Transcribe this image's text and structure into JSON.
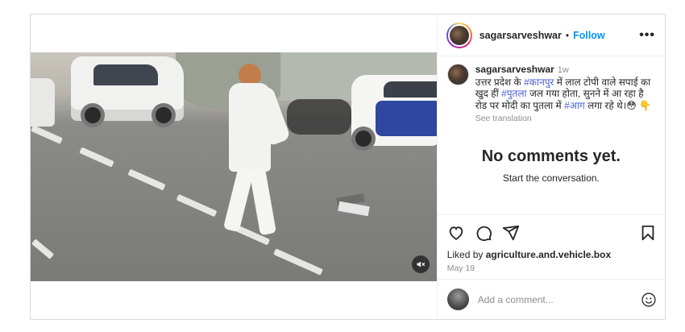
{
  "post": {
    "username": "sagarsarveshwar",
    "follow_label": "Follow",
    "more_label": "•••",
    "separator": "•"
  },
  "caption": {
    "username": "sagarsarveshwar",
    "time": "1w",
    "part1": "उत्तर प्रदेश के ",
    "tag1": "#कानपुर",
    "part2": " में लाल टोपी वाले सपाई का खुद हीं ",
    "tag2": "#पुतला",
    "part3": " जल गया होता, सुनने में आ रहा है रोड पर मोदी का पुतला में ",
    "tag3": "#आग",
    "part4": " लगा रहे थे।",
    "emojis": "😳 👇",
    "see_translation": "See translation"
  },
  "comments": {
    "empty_title": "No comments yet.",
    "empty_subtitle": "Start the conversation."
  },
  "actions": {
    "like_icon": "heart-icon",
    "comment_icon": "comment-icon",
    "share_icon": "share-icon",
    "save_icon": "bookmark-icon",
    "liked_prefix": "Liked by ",
    "liked_user": "agriculture.and.vehicle.box",
    "date": "May 19"
  },
  "composer": {
    "placeholder": "Add a comment...",
    "emoji_icon": "smiley-icon"
  },
  "media": {
    "mute_icon": "muted-speaker-icon"
  }
}
